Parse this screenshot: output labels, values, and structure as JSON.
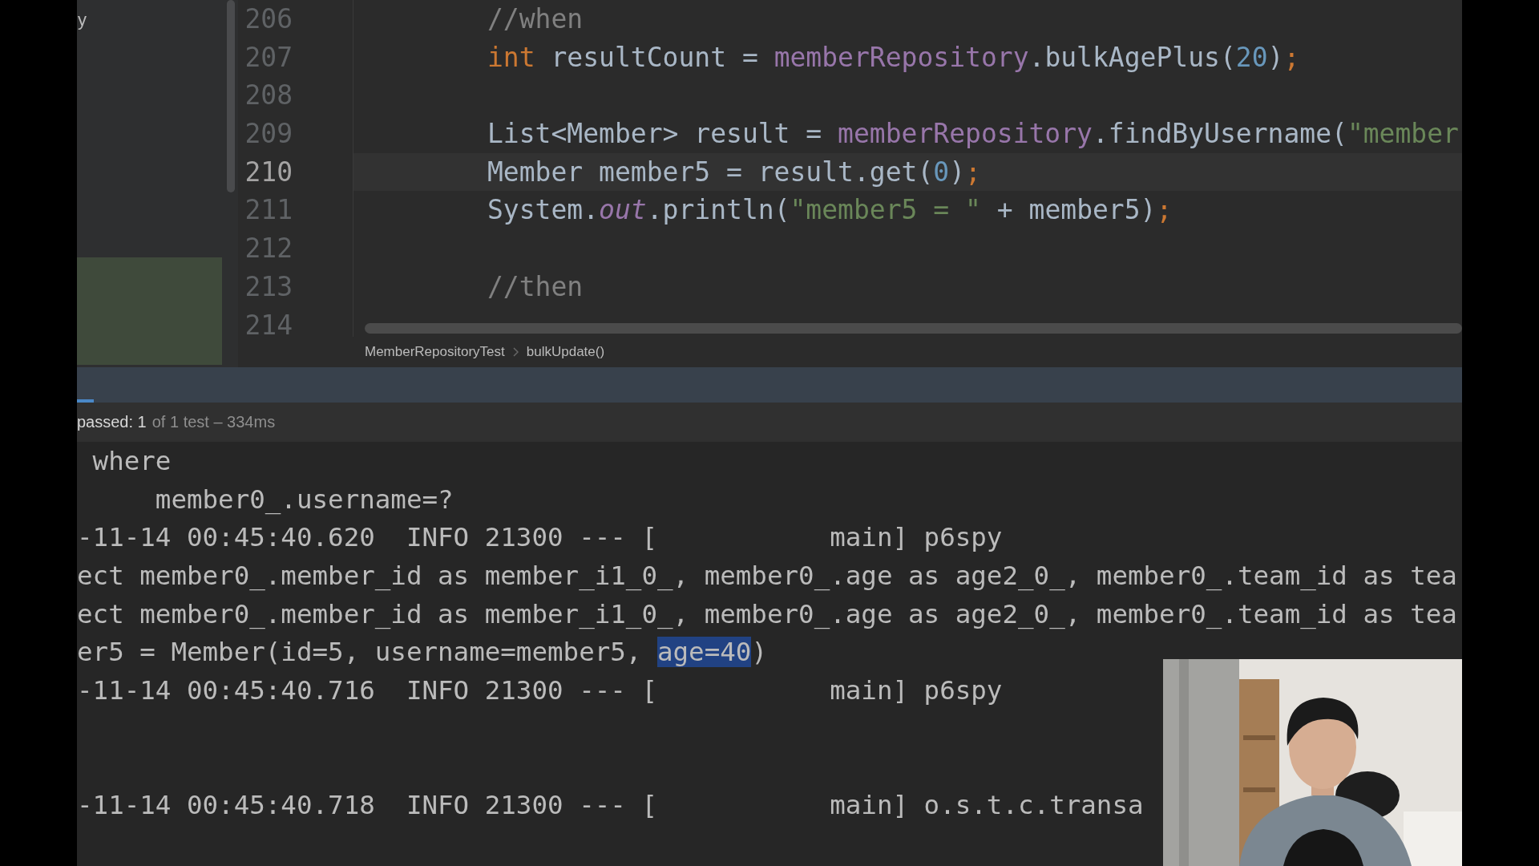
{
  "sidebar": {
    "label": "y"
  },
  "editor": {
    "lines": [
      {
        "number": "206",
        "current": false,
        "segments": [
          {
            "kind": "comment",
            "text": "//when"
          }
        ]
      },
      {
        "number": "207",
        "current": false,
        "segments": [
          {
            "kind": "keyword",
            "text": "int"
          },
          {
            "kind": "plain",
            "text": " resultCount = "
          },
          {
            "kind": "field",
            "text": "memberRepository"
          },
          {
            "kind": "plain",
            "text": ".bulkAgePlus("
          },
          {
            "kind": "number",
            "text": "20"
          },
          {
            "kind": "plain",
            "text": ")"
          },
          {
            "kind": "keyword",
            "text": ";"
          }
        ]
      },
      {
        "number": "208",
        "current": false
      },
      {
        "number": "209",
        "current": false,
        "segments": [
          {
            "kind": "plain",
            "text": "List<Member> result = "
          },
          {
            "kind": "field",
            "text": "memberRepository"
          },
          {
            "kind": "plain",
            "text": ".findByUsername("
          },
          {
            "kind": "string",
            "text": "\"member"
          }
        ]
      },
      {
        "number": "210",
        "current": true,
        "segments": [
          {
            "kind": "plain",
            "text": "Member member5 = result.get("
          },
          {
            "kind": "number",
            "text": "0"
          },
          {
            "kind": "plain",
            "text": ")"
          },
          {
            "kind": "keyword",
            "text": ";"
          }
        ]
      },
      {
        "number": "211",
        "current": false,
        "segments": [
          {
            "kind": "plain",
            "text": "System."
          },
          {
            "kind": "static",
            "text": "out"
          },
          {
            "kind": "plain",
            "text": ".println("
          },
          {
            "kind": "string",
            "text": "\"member5 = \""
          },
          {
            "kind": "plain",
            "text": " + member5)"
          },
          {
            "kind": "keyword",
            "text": ";"
          }
        ]
      },
      {
        "number": "212",
        "current": false
      },
      {
        "number": "213",
        "current": false,
        "segments": [
          {
            "kind": "comment",
            "text": "//then"
          }
        ]
      },
      {
        "number": "214",
        "current": false
      }
    ]
  },
  "breadcrumbs": [
    "MemberRepositoryTest",
    "bulkUpdate()"
  ],
  "run_panel": {
    "status": {
      "result": "passed: 1",
      "detail": "of 1 test – 334ms"
    },
    "console": [
      {
        "segments": [
          {
            "text": " where",
            "selected": false
          }
        ]
      },
      {
        "segments": [
          {
            "text": "     member0_.username=?",
            "selected": false
          }
        ]
      },
      {
        "segments": [
          {
            "text": "-11-14 00:45:40.620  INFO 21300 --- [           main] p6spy",
            "selected": false
          }
        ]
      },
      {
        "segments": [
          {
            "text": "ect member0_.member_id as member_i1_0_, member0_.age as age2_0_, member0_.team_id as tea",
            "selected": false
          }
        ]
      },
      {
        "segments": [
          {
            "text": "ect member0_.member_id as member_i1_0_, member0_.age as age2_0_, member0_.team_id as tea",
            "selected": false
          }
        ]
      },
      {
        "segments": [
          {
            "text": "er5 = Member(id=5, username=member5, ",
            "selected": false
          },
          {
            "text": "age=40",
            "selected": true
          },
          {
            "text": ")",
            "selected": false
          }
        ]
      },
      {
        "segments": [
          {
            "text": "-11-14 00:45:40.716  INFO 21300 --- [           main] p6spy",
            "selected": false
          }
        ]
      },
      {
        "kind": "blank"
      },
      {
        "kind": "blank"
      },
      {
        "segments": [
          {
            "text": "-11-14 00:45:40.718  INFO 21300 --- [           main] o.s.t.c.transa",
            "selected": false
          }
        ]
      }
    ]
  },
  "webcam": {
    "kind": "picture"
  }
}
